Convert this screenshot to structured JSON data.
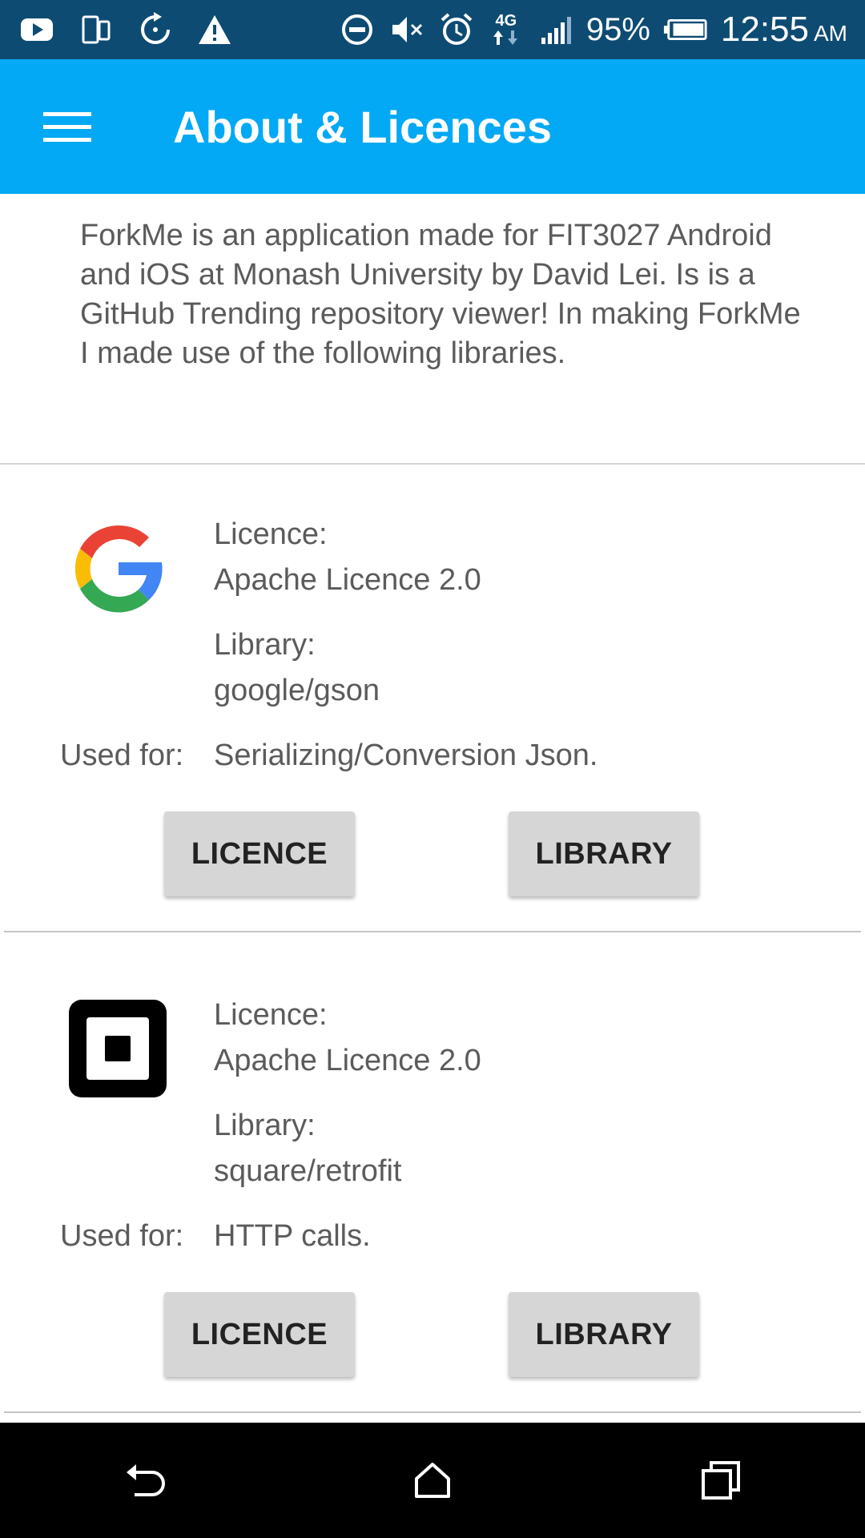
{
  "status_bar": {
    "battery": "95%",
    "time": "12:55",
    "ampm": "AM",
    "network": "4G",
    "icons": [
      "youtube-icon",
      "phone-icon",
      "sync-icon",
      "warning-icon",
      "dnd-icon",
      "mute-icon",
      "alarm-icon",
      "network-4g-icon",
      "signal-icon",
      "battery-icon"
    ]
  },
  "app_bar": {
    "title": "About & Licences",
    "menu_icon": "hamburger-menu-icon",
    "color": "#03a9f4"
  },
  "intro": {
    "text": "ForkMe is an application made for FIT3027 Android and iOS at Monash University by David Lei. Is is a GitHub Trending repository viewer! In making ForkMe I made use of the following libraries."
  },
  "libraries": [
    {
      "logo": "google-logo-icon",
      "licence_label": "Licence:",
      "licence": "Apache Licence 2.0",
      "library_label": "Library:",
      "library": "google/gson",
      "used_for_label": "Used for:",
      "used_for": "Serializing/Conversion Json.",
      "licence_button": "LICENCE",
      "library_button": "LIBRARY"
    },
    {
      "logo": "square-logo-icon",
      "licence_label": "Licence:",
      "licence": "Apache Licence 2.0",
      "library_label": "Library:",
      "library": "square/retrofit",
      "used_for_label": "Used for:",
      "used_for": "HTTP calls.",
      "licence_button": "LICENCE",
      "library_button": "LIBRARY"
    }
  ],
  "nav_bar": {
    "icons": [
      "back-icon",
      "home-icon",
      "recents-icon"
    ]
  }
}
